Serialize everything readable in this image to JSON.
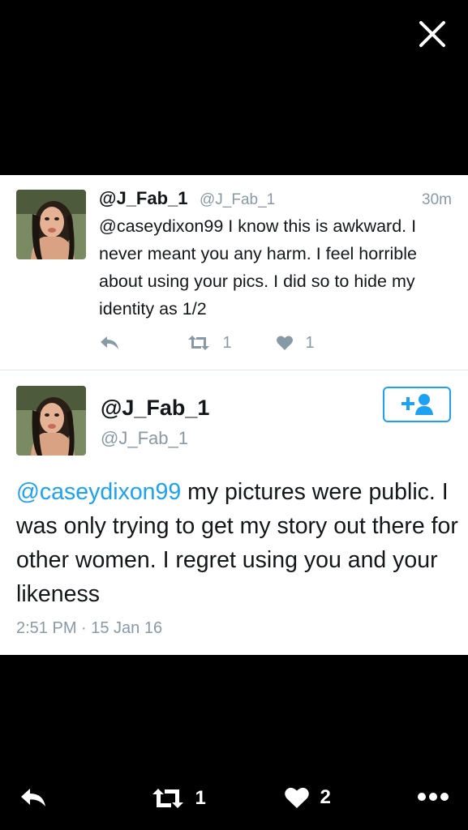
{
  "tweets": [
    {
      "display_name": "@J_Fab_1",
      "handle": "@J_Fab_1",
      "time": "30m",
      "text": "@caseydixon99 I know this is awkward. I never meant you any harm. I feel horrible about using your pics. I did so to hide my identity as 1/2",
      "retweets": "1",
      "likes": "1"
    },
    {
      "display_name": "@J_Fab_1",
      "handle": "@J_Fab_1",
      "mention": "@caseydixon99",
      "text": " my pictures were public. I was only trying to get my story out there for other women. I regret using you and your likeness",
      "timestamp": "2:51 PM · 15 Jan 16"
    }
  ],
  "bottom_bar": {
    "retweets": "1",
    "likes": "2"
  },
  "icons": {
    "close": "close-icon",
    "reply": "reply-icon",
    "retweet": "retweet-icon",
    "like": "heart-icon",
    "follow": "add-user-icon",
    "more": "more-icon"
  },
  "colors": {
    "accent": "#1da1f2",
    "muted": "#8899a6"
  }
}
